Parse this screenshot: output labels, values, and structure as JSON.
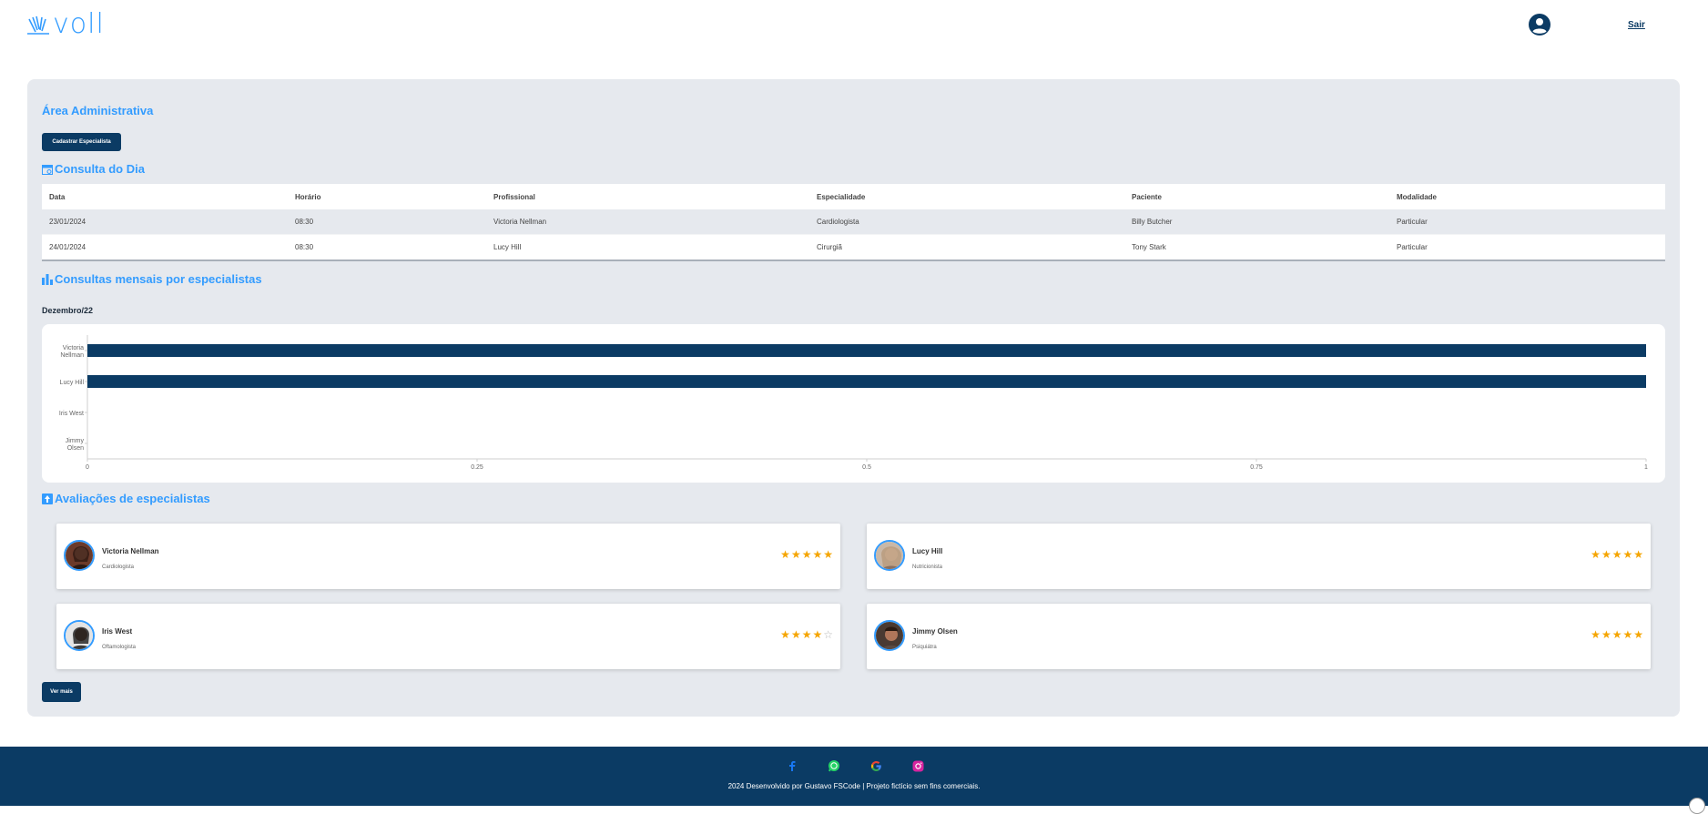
{
  "brand": {
    "logo_text": "voll",
    "accent": "#339cff",
    "dark": "#0b3b64"
  },
  "header": {
    "logout_label": "Sair",
    "user_icon": "user-circle-icon"
  },
  "admin": {
    "title": "Área Administrativa",
    "register_button": "Cadastrar Especialista"
  },
  "consultas": {
    "title": "Consulta do Dia",
    "columns": [
      "Data",
      "Horário",
      "Profissional",
      "Especialidade",
      "Paciente",
      "Modalidade"
    ],
    "rows": [
      [
        "23/01/2024",
        "08:30",
        "Victoria Nellman",
        "Cardiologista",
        "Billy Butcher",
        "Particular"
      ],
      [
        "24/01/2024",
        "08:30",
        "Lucy Hill",
        "Cirurgiã",
        "Tony Stark",
        "Particular"
      ]
    ]
  },
  "mensais": {
    "title": "Consultas mensais por especialistas",
    "month": "Dezembro/22"
  },
  "chart_data": {
    "type": "bar",
    "orientation": "horizontal",
    "categories": [
      "Victoria Nellman",
      "Lucy Hill",
      "Iris West",
      "Jimmy Olsen"
    ],
    "values": [
      1,
      1,
      0,
      0
    ],
    "xlim": [
      0,
      1
    ],
    "xticks": [
      "0",
      "0.25",
      "0.5",
      "0.75",
      "1"
    ],
    "color": "#0b3b64",
    "grid": false
  },
  "avaliacoes": {
    "title": "Avaliações de especialistas",
    "items": [
      {
        "name": "Victoria Nellman",
        "specialty": "Cardiologista",
        "rating": 5
      },
      {
        "name": "Lucy Hill",
        "specialty": "Nutricionista",
        "rating": 5
      },
      {
        "name": "Iris West",
        "specialty": "Oftamologista",
        "rating": 4
      },
      {
        "name": "Jimmy Olsen",
        "specialty": "Psiquiátra",
        "rating": 5
      }
    ],
    "more_button": "Ver mais"
  },
  "footer": {
    "social_icons": [
      "facebook-icon",
      "whatsapp-icon",
      "google-icon",
      "instagram-icon"
    ],
    "text": "2024 Desenvolvido por Gustavo FSCode | Projeto fictício sem fins comerciais."
  }
}
